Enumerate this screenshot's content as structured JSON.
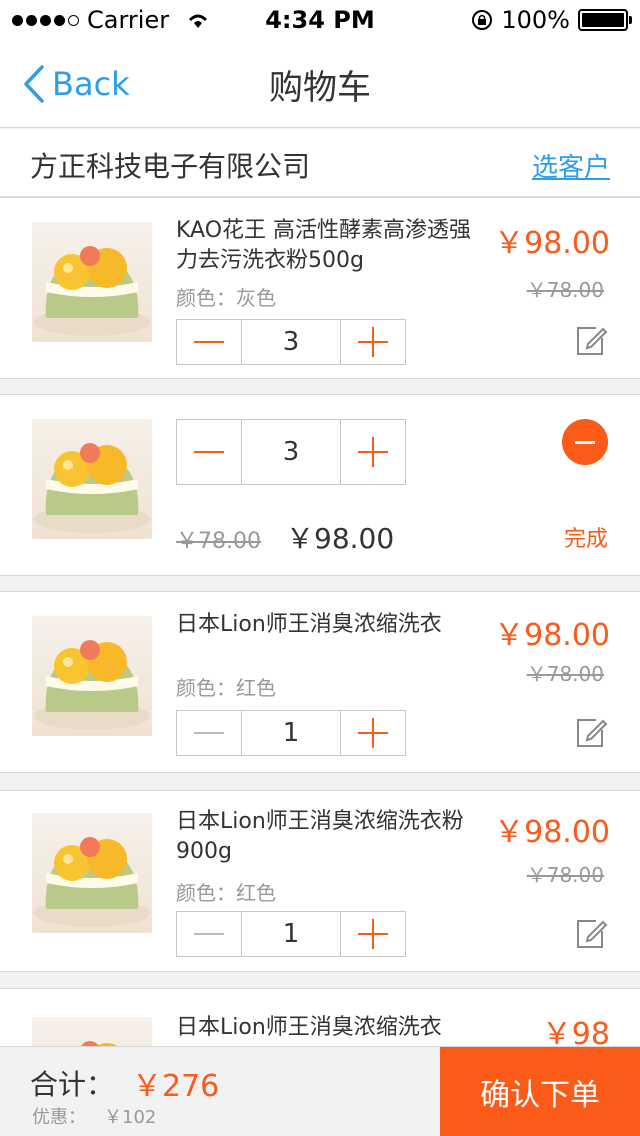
{
  "status_bar": {
    "carrier": "Carrier",
    "time": "4:34 PM",
    "battery": "100%"
  },
  "nav": {
    "back_label": "Back",
    "title": "购物车"
  },
  "company": {
    "name": "方正科技电子有限公司",
    "select_customer": "选客户"
  },
  "items": [
    {
      "name": "KAO花王 高活性酵素高渗透强力去污洗衣粉500g",
      "color": "颜色：灰色",
      "price": "￥98.00",
      "orig_price": "￥78.00",
      "quantity": "3"
    },
    {
      "quantity": "3",
      "orig_price": "￥78.00",
      "price": "￥98.00",
      "done_label": "完成"
    },
    {
      "name": "日本Lion师王消臭浓缩洗衣",
      "color": "颜色：红色",
      "price": "￥98.00",
      "orig_price": "￥78.00",
      "quantity": "1"
    },
    {
      "name": "日本Lion师王消臭浓缩洗衣粉900g",
      "color": "颜色：红色",
      "price": "￥98.00",
      "orig_price": "￥78.00",
      "quantity": "1"
    },
    {
      "name": "日本Lion师王消臭浓缩洗衣",
      "price": "￥98"
    }
  ],
  "footer": {
    "total_label": "合计：",
    "total_value": "￥276",
    "discount_label": "优惠：",
    "discount_value": "￥102",
    "confirm_label": "确认下单"
  },
  "colors": {
    "accent": "#fb5a18",
    "link": "#2c9fe8"
  }
}
